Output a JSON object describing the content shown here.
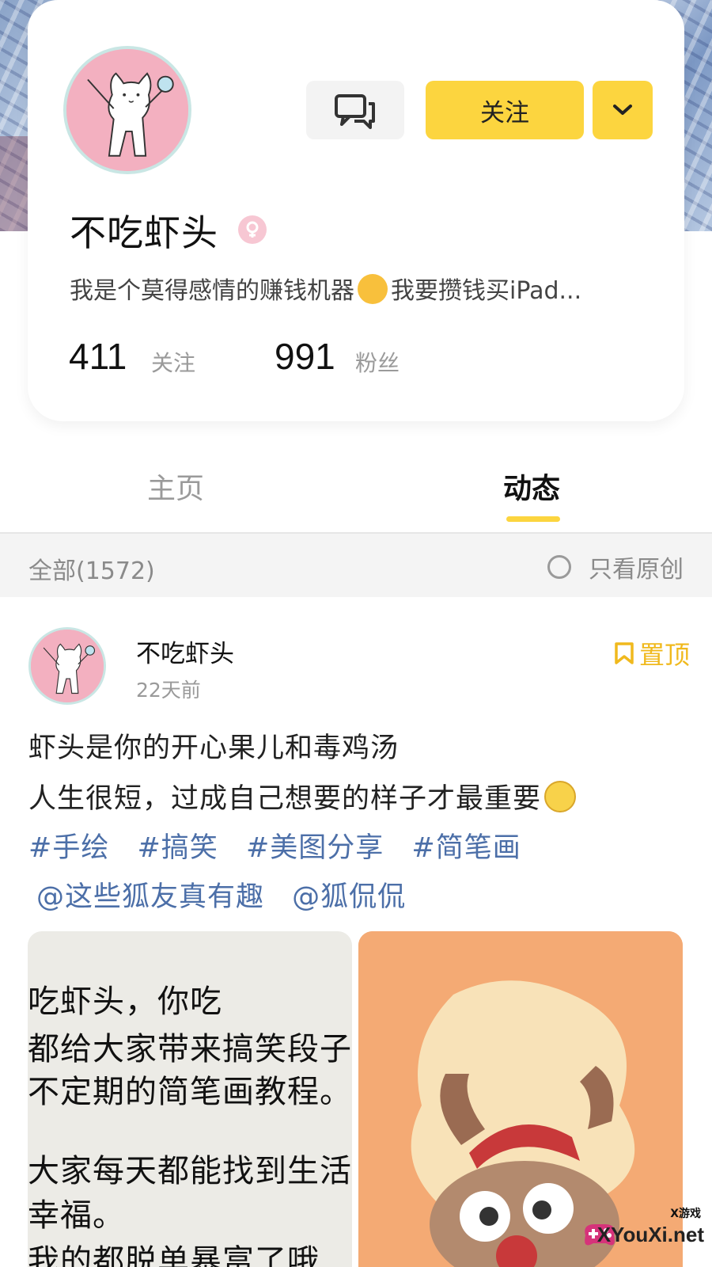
{
  "profile": {
    "username": "不吃虾头",
    "bio": "我是个莫得感情的赚钱机器",
    "bio_suffix": "我要攒钱买iPad...",
    "follow_button": "关注",
    "stats": [
      {
        "value": "411",
        "label": "关注"
      },
      {
        "value": "991",
        "label": "粉丝"
      }
    ]
  },
  "tabs": [
    {
      "label": "主页",
      "active": false
    },
    {
      "label": "动态",
      "active": true
    }
  ],
  "filter": {
    "all_label": "全部(1572)",
    "original_only_label": "只看原创"
  },
  "post": {
    "author": "不吃虾头",
    "time": "22天前",
    "pinned_label": "置顶",
    "lines": [
      "虾头是你的开心果儿和毒鸡汤",
      "人生很短，过成自己想要的样子才最重要"
    ],
    "tags": [
      "#手绘",
      "#搞笑",
      "#美图分享",
      "#简笔画"
    ],
    "mentions": [
      "@这些狐友真有趣",
      "@狐侃侃"
    ],
    "image_left_text": [
      "吃虾头，你吃",
      "都给大家带来搞笑段子",
      "不定期的简笔画教程。",
      "大家每天都能找到生活",
      "幸福。",
      "我的都脱单暴富了哦"
    ]
  },
  "watermark": {
    "top": "X游戏",
    "main": "XYouXi.net"
  },
  "colors": {
    "accent_yellow": "#fcd53f",
    "tag_blue": "#4c6fa8",
    "pinned_gold": "#f0b91d"
  }
}
